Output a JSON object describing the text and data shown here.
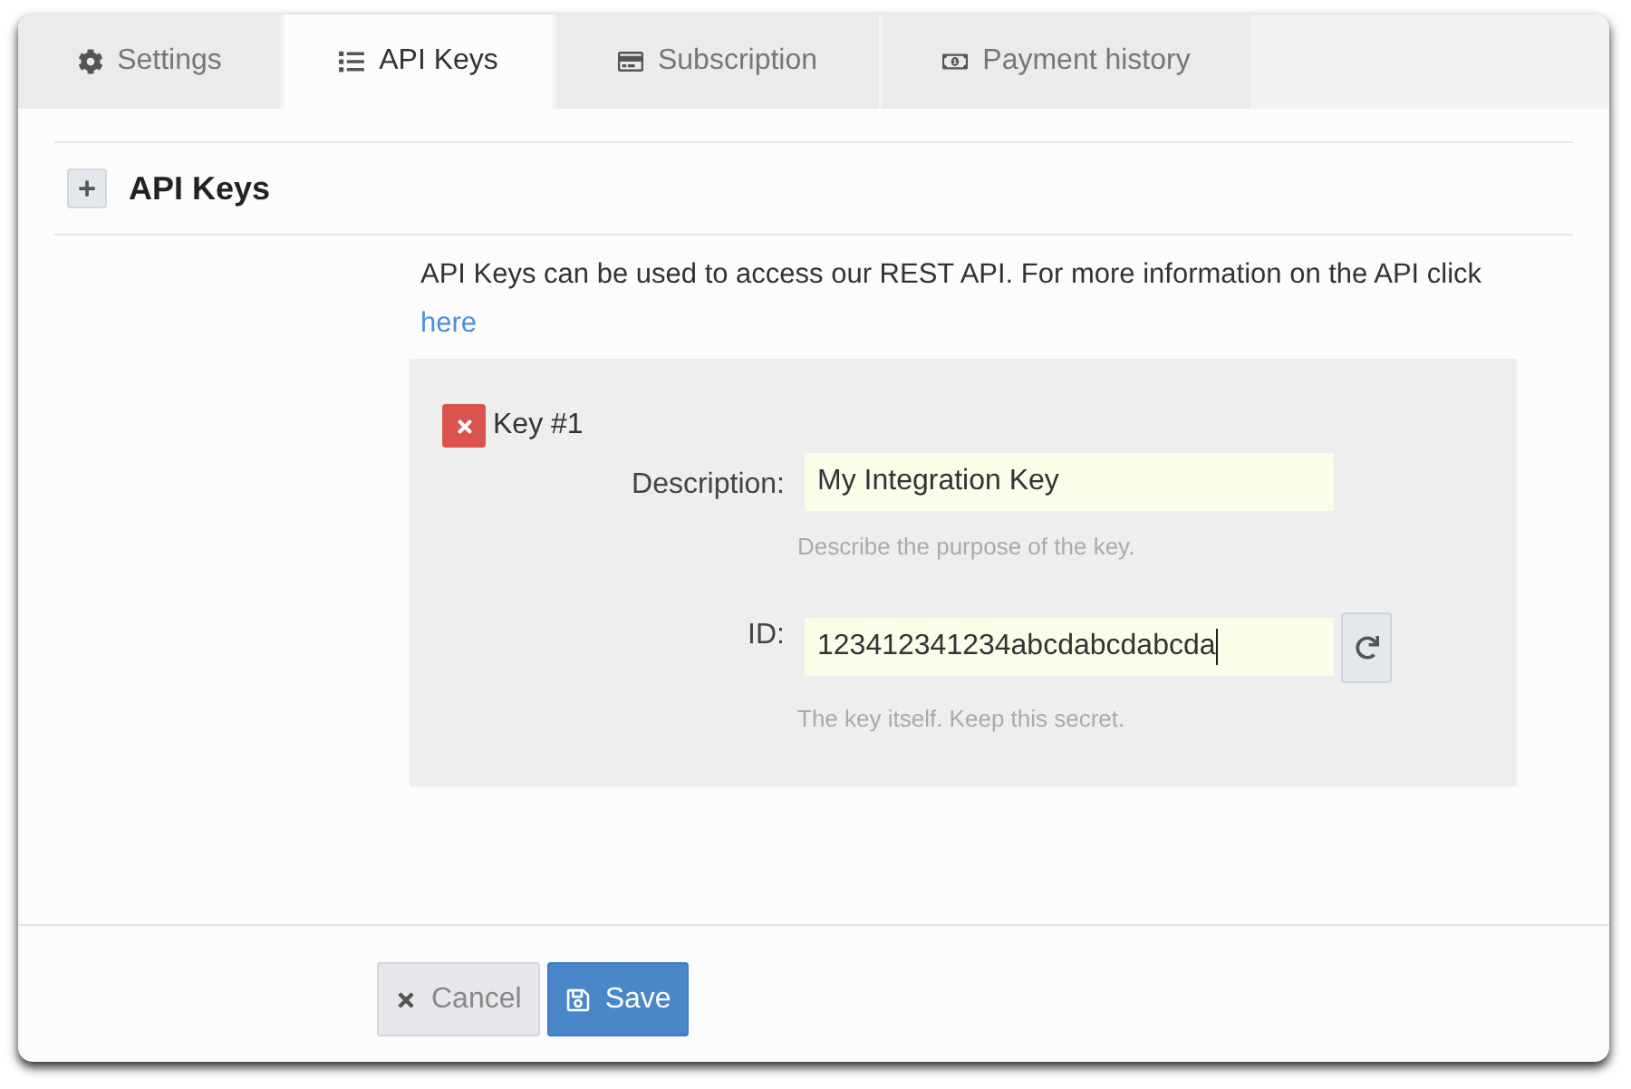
{
  "tabs": [
    {
      "label": "Settings",
      "selected": false
    },
    {
      "label": "API Keys",
      "selected": true
    },
    {
      "label": "Subscription",
      "selected": false
    },
    {
      "label": "Payment history",
      "selected": false
    }
  ],
  "section": {
    "title": "API Keys"
  },
  "intro": {
    "text": "API Keys can be used to access our REST API. For more information on the API click",
    "link": "here"
  },
  "keys": [
    {
      "title": "Key #1",
      "fields": [
        {
          "kind": "plain",
          "label": "Description:",
          "value": "My Integration Key",
          "help": "Describe the purpose of the key.",
          "focused": false
        },
        {
          "kind": "regenerable",
          "label": "ID:",
          "value": "123412341234abcdabcdabcda",
          "help": "The key itself. Keep this secret.",
          "focused": true
        }
      ]
    }
  ],
  "buttons": [
    {
      "kind": "secondary",
      "label": "Cancel"
    },
    {
      "kind": "primary",
      "label": "Save"
    }
  ]
}
